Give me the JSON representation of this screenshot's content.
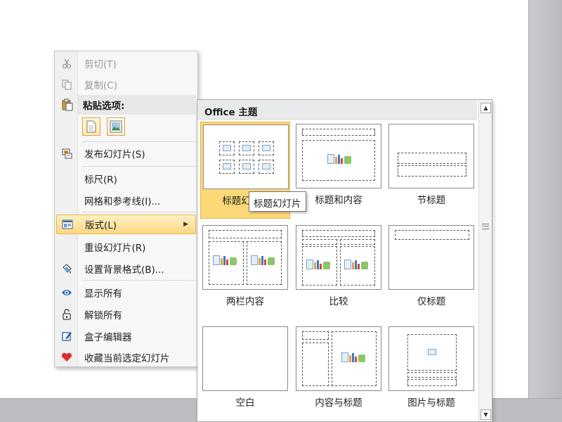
{
  "context_menu": {
    "items": [
      {
        "label": "剪切(T)",
        "icon": "scissors-icon",
        "disabled": true
      },
      {
        "label": "复制(C)",
        "icon": "copy-icon",
        "disabled": true
      },
      {
        "label": "粘贴选项:",
        "icon": "paste-icon",
        "disabled": false
      },
      {
        "label": "发布幻灯片(S)",
        "icon": "publish-slide-icon"
      },
      {
        "label": "标尺(R)"
      },
      {
        "label": "网格和参考线(I)..."
      },
      {
        "label": "版式(L)",
        "icon": "layout-icon",
        "highlighted": true
      },
      {
        "label": "重设幻灯片(R)"
      },
      {
        "label": "设置背景格式(B)...",
        "icon": "format-background-icon"
      },
      {
        "label": "显示所有",
        "icon": "eye-icon"
      },
      {
        "label": "解锁所有",
        "icon": "unlock-icon"
      },
      {
        "label": "盒子编辑器",
        "icon": "edit-icon"
      },
      {
        "label": "收藏当前选定幻灯片",
        "icon": "heart-icon"
      }
    ],
    "paste_buttons": [
      "paste-use-destination-theme-icon",
      "paste-picture-icon"
    ]
  },
  "gallery": {
    "title": "Office 主题",
    "layouts": [
      {
        "label": "标题幻灯片",
        "selected": true
      },
      {
        "label": "标题和内容"
      },
      {
        "label": "节标题"
      },
      {
        "label": "两栏内容"
      },
      {
        "label": "比较"
      },
      {
        "label": "仅标题"
      },
      {
        "label": "空白"
      },
      {
        "label": "内容与标题"
      },
      {
        "label": "图片与标题"
      }
    ]
  },
  "tooltip": {
    "text": "标题幻灯片"
  },
  "colors": {
    "highlight": "#fbd978",
    "highlight_border": "#e8b444",
    "menu_bg": "#f7f7f7",
    "gallery_header": "#e9eaec"
  }
}
